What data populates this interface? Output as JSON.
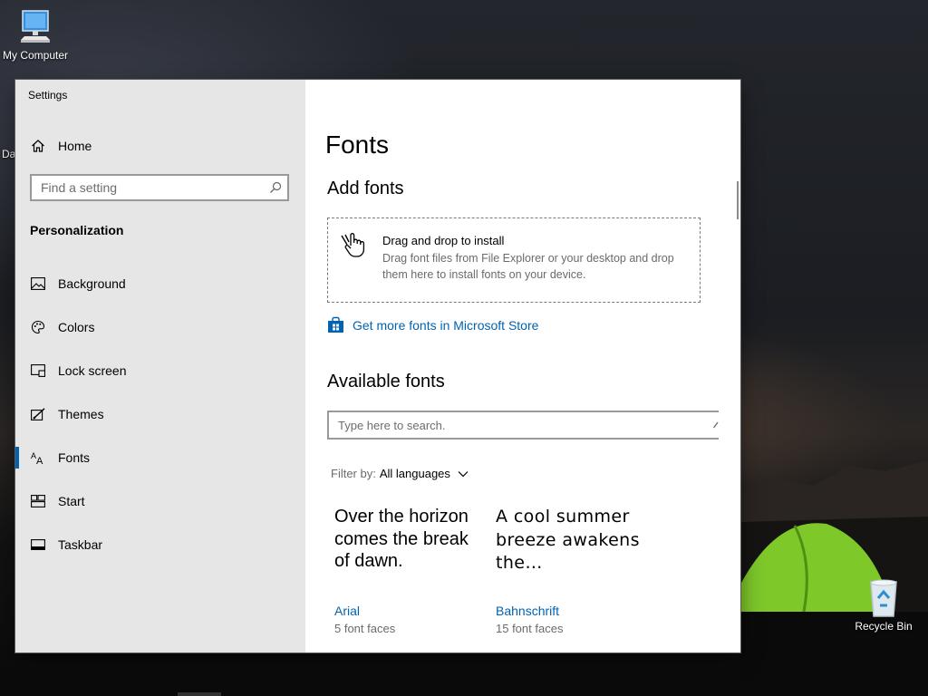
{
  "desktop": {
    "my_computer_label": "My Computer",
    "recycle_bin_label": "Recycle Bin",
    "partial_label": "Da"
  },
  "window": {
    "title": "Settings",
    "controls": [
      "minimize",
      "maximize",
      "close"
    ]
  },
  "sidebar": {
    "home_label": "Home",
    "search_placeholder": "Find a setting",
    "section_title": "Personalization",
    "items": [
      {
        "label": "Background",
        "icon": "picture-icon"
      },
      {
        "label": "Colors",
        "icon": "palette-icon"
      },
      {
        "label": "Lock screen",
        "icon": "lock-screen-icon"
      },
      {
        "label": "Themes",
        "icon": "themes-icon"
      },
      {
        "label": "Fonts",
        "icon": "fonts-icon",
        "active": true
      },
      {
        "label": "Start",
        "icon": "start-icon"
      },
      {
        "label": "Taskbar",
        "icon": "taskbar-icon"
      }
    ]
  },
  "main": {
    "page_title": "Fonts",
    "add_fonts_heading": "Add fonts",
    "drop_title": "Drag and drop to install",
    "drop_description": "Drag font files from File Explorer or your desktop and drop them here to install fonts on your device.",
    "store_link": "Get more fonts in Microsoft Store",
    "available_heading": "Available fonts",
    "search_placeholder": "Type here to search.",
    "filter_label": "Filter by:",
    "filter_value": "All languages",
    "fonts": [
      {
        "sample": "Over the horizon comes the break of dawn.",
        "name": "Arial",
        "faces": "5 font faces"
      },
      {
        "sample": "A cool summer breeze awakens the…",
        "name": "Bahnschrift",
        "faces": "15 font faces"
      }
    ]
  },
  "colors": {
    "accent": "#0063b1",
    "sidebar_bg": "#e6e6e6",
    "secondary_text": "#6b6b6b"
  }
}
